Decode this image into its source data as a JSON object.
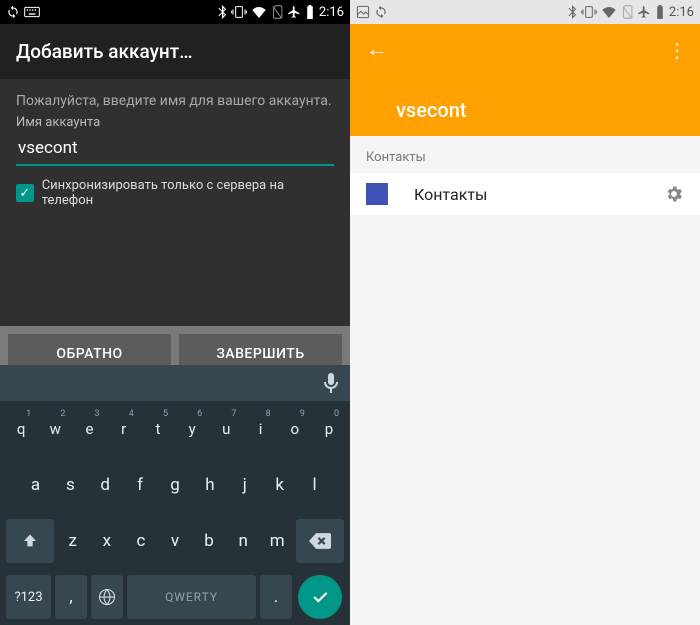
{
  "status": {
    "time": "2:16"
  },
  "left": {
    "title": "Добавить аккаунт…",
    "instruction": "Пожалуйста, введите имя для вашего аккаунта.",
    "field_label": "Имя аккаунта",
    "field_value": "vsecont",
    "checkbox_label": "Синхронизировать только с сервера на телефон",
    "btn_back": "ОБРАТНО",
    "btn_done": "ЗАВЕРШИТЬ"
  },
  "keyboard": {
    "row1": [
      {
        "k": "q",
        "s": "1"
      },
      {
        "k": "w",
        "s": "2"
      },
      {
        "k": "e",
        "s": "3"
      },
      {
        "k": "r",
        "s": "4"
      },
      {
        "k": "t",
        "s": "5"
      },
      {
        "k": "y",
        "s": "6"
      },
      {
        "k": "u",
        "s": "7"
      },
      {
        "k": "i",
        "s": "8"
      },
      {
        "k": "o",
        "s": "9"
      },
      {
        "k": "p",
        "s": "0"
      }
    ],
    "row2": [
      "a",
      "s",
      "d",
      "f",
      "g",
      "h",
      "j",
      "k",
      "l"
    ],
    "row3": [
      "z",
      "x",
      "c",
      "v",
      "b",
      "n",
      "m"
    ],
    "symkey": "?123",
    "space": "QWERTY",
    "comma": ",",
    "period": "."
  },
  "right": {
    "title": "vsecont",
    "section": "Контакты",
    "item": "Контакты"
  }
}
